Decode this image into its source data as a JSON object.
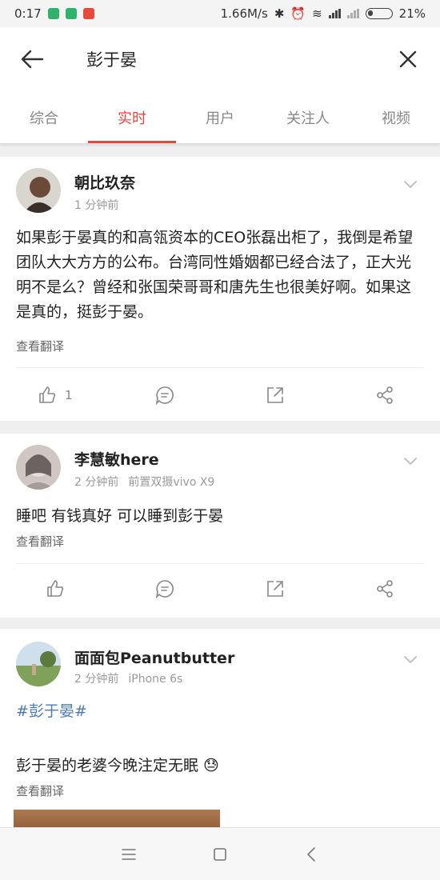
{
  "status_bar": {
    "time": "0:17",
    "speed": "1.66M/s",
    "battery": "21%",
    "app_colors": [
      "#2fb26b",
      "#2fb26b",
      "#e64a3b"
    ]
  },
  "header": {
    "query": "彭于晏"
  },
  "tabs": [
    {
      "label": "综合",
      "active": false
    },
    {
      "label": "实时",
      "active": true
    },
    {
      "label": "用户",
      "active": false
    },
    {
      "label": "关注人",
      "active": false
    },
    {
      "label": "视频",
      "active": false
    }
  ],
  "posts": [
    {
      "username": "朝比玖奈",
      "time": "1 分钟前",
      "source": "",
      "text": "如果彭于晏真的和高瓴资本的CEO张磊出柜了，我倒是希望团队大大方方的公布。台湾同性婚姻都已经合法了，正大光明不是么？曾经和张国荣哥哥和唐先生也很美好啊。如果这是真的，挺彭于晏。",
      "translate": "查看翻译",
      "like_count": "1"
    },
    {
      "username": "李慧敏here",
      "time": "2 分钟前",
      "source": "前置双摄vivo X9",
      "text": "睡吧 有钱真好 可以睡到彭于晏",
      "translate": "查看翻译",
      "like_count": ""
    },
    {
      "username": "面面包Peanutbutter",
      "time": "2 分钟前",
      "source": "iPhone 6s",
      "hashtag": "#彭于晏#",
      "text": "彭于晏的老婆今晚注定无眠 😓",
      "translate": "查看翻译"
    }
  ],
  "colors": {
    "accent": "#e8473d",
    "link": "#4a7cb5",
    "meta": "#9a9a9a"
  },
  "icons": {
    "header": [
      "back-arrow-icon",
      "close-icon"
    ],
    "actions": [
      "thumbs-up-icon",
      "comment-icon",
      "repost-icon",
      "share-icon"
    ],
    "nav": [
      "menu-icon",
      "home-icon",
      "back-icon"
    ]
  }
}
